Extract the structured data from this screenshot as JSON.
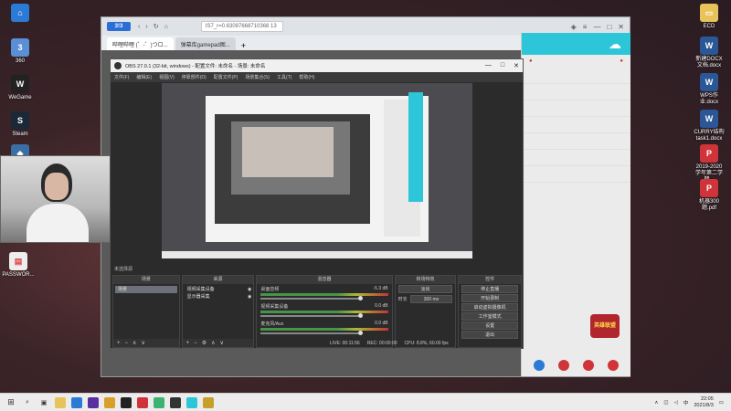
{
  "desktop": {
    "left_icons": [
      {
        "label": "",
        "color": "#2b7bd6"
      },
      {
        "label": "360",
        "color": "#5a8fd8"
      },
      {
        "label": "WeGame",
        "color": "#222"
      },
      {
        "label": "Steam",
        "color": "#1b2838"
      },
      {
        "label": "",
        "color": "#3a6ea5"
      },
      {
        "label": "PASSWOR...",
        "color": "#d44"
      }
    ],
    "right_icons": [
      {
        "label": "ECD",
        "color": "#888"
      },
      {
        "label": "新建DOCX 文档.docx",
        "color": "#2b5797"
      },
      {
        "label": "WPS作业.docx",
        "color": "#2b5797"
      },
      {
        "label": "CURRY结构 task1.docx",
        "color": "#2b5797"
      },
      {
        "label": "2019-2020 学年第二学期...",
        "color": "#d13438"
      },
      {
        "label": "机器300题.pdf",
        "color": "#d13438"
      }
    ]
  },
  "browser": {
    "logo": "3!3",
    "address": "IS7_r=0.63097668710368 13",
    "tabs": [
      {
        "label": "哔哩哔哩 (゜-゜)つロ..."
      },
      {
        "label": "弹幕库gamepad图..."
      }
    ],
    "new_tab": "+"
  },
  "obs": {
    "title": "OBS 27.0.1 (32-bit, windows) - 配置文件: 未命名 - 场景: 未命名",
    "menu": [
      "文件(F)",
      "编辑(E)",
      "视图(V)",
      "停靠部件(D)",
      "配置文件(P)",
      "场景集合(S)",
      "工具(T)",
      "帮助(H)"
    ],
    "scenes_header": "场景",
    "scenes": [
      "场景"
    ],
    "sources_header": "来源",
    "sources": [
      "视频采集设备",
      "显示器采集"
    ],
    "mixer_header": "混音器",
    "mixer": [
      {
        "name": "桌面音频",
        "level": "-5.3 dB"
      },
      {
        "name": "视频采集设备",
        "level": "0.0 dB"
      },
      {
        "name": "麦克风/Aux",
        "level": "0.0 dB"
      }
    ],
    "transitions_header": "转场特效",
    "transition_type": "淡出",
    "duration_label": "时长",
    "duration_value": "300 ms",
    "controls_header": "控件",
    "controls": [
      "停止直播",
      "开始录制",
      "启动虚拟摄像机",
      "工作室模式",
      "设置",
      "退出"
    ],
    "status": [
      "LIVE: 00:11:56",
      "REC: 00:00:00",
      "CPU: 8.8%, 60.00 fps"
    ],
    "preview_label": "未选择源"
  },
  "taskbar": {
    "icons": [
      "start",
      "search",
      "task-view",
      "files",
      "edge",
      "photoshop",
      "chrome",
      "qq",
      "netease",
      "wechat",
      "obs",
      "browser",
      "game"
    ],
    "time": "22:05",
    "date": "2021/8/3",
    "lang": "中"
  },
  "overlay_badge": "英雄联盟",
  "colors": {
    "accent": "#2dc6d8",
    "obs_bg": "#2b2b2b",
    "browser_brand": "#2b6fd6"
  }
}
